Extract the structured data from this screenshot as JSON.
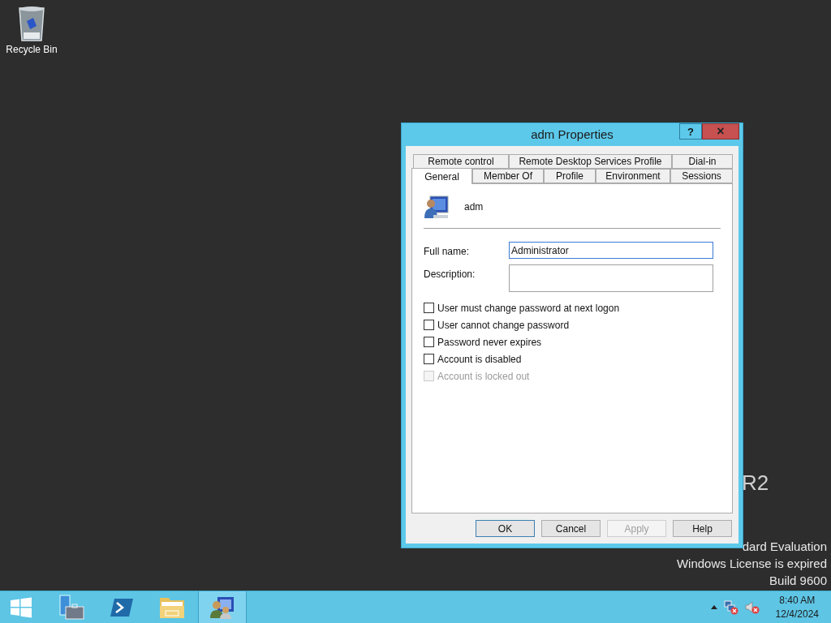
{
  "desktop": {
    "icons": [
      {
        "label": "Recycle Bin"
      }
    ],
    "branding": {
      "edition_tail": "R2",
      "lines": [
        "dard Evaluation",
        "Windows License is expired",
        "Build 9600"
      ]
    }
  },
  "dialog": {
    "title": "adm Properties",
    "title_buttons": [
      "?",
      "×"
    ],
    "tab_rows": [
      [
        {
          "label": "Remote control",
          "selected": false
        },
        {
          "label": "Remote Desktop Services Profile",
          "selected": false
        },
        {
          "label": "Dial-in",
          "selected": false
        }
      ],
      [
        {
          "label": "General",
          "selected": true
        },
        {
          "label": "Member Of",
          "selected": false
        },
        {
          "label": "Profile",
          "selected": false
        },
        {
          "label": "Environment",
          "selected": false
        },
        {
          "label": "Sessions",
          "selected": false
        }
      ]
    ],
    "user": "adm",
    "fields": [
      {
        "label": "Full name:",
        "value": "Administrator",
        "focused": true
      },
      {
        "label": "Description:",
        "focused": false
      }
    ],
    "checkboxes": [
      {
        "label": "User must change password at next logon",
        "checked": false,
        "disabled": false
      },
      {
        "label": "User cannot change password",
        "checked": false,
        "disabled": false
      },
      {
        "label": "Password never expires",
        "checked": false,
        "disabled": false
      },
      {
        "label": "Account is disabled",
        "checked": false,
        "disabled": false
      },
      {
        "label": "Account is locked out",
        "checked": false,
        "disabled": true
      }
    ],
    "buttons": [
      {
        "label": "OK",
        "disabled": false,
        "default": true
      },
      {
        "label": "Cancel",
        "disabled": false,
        "default": false
      },
      {
        "label": "Apply",
        "disabled": true,
        "default": false
      },
      {
        "label": "Help",
        "disabled": false,
        "default": false
      }
    ]
  },
  "taskbar": {
    "apps": [
      {
        "kind": "start",
        "active": false
      },
      {
        "kind": "server",
        "active": false
      },
      {
        "kind": "shell",
        "active": false
      },
      {
        "kind": "folder",
        "active": false
      },
      {
        "kind": "users",
        "active": true
      }
    ],
    "tray": {
      "time": "8:40 AM",
      "date": "12/4/2024"
    }
  }
}
